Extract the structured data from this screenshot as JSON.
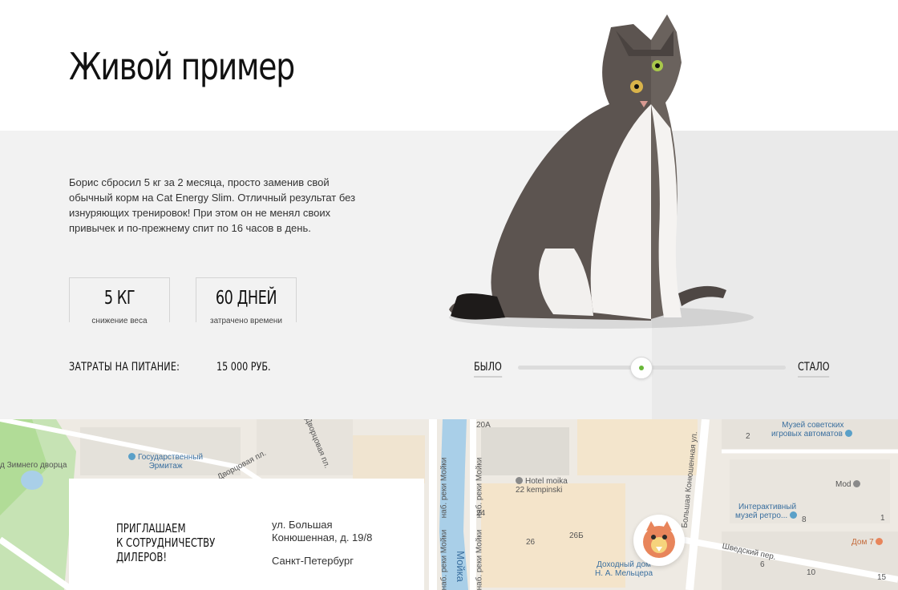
{
  "example": {
    "title": "Живой пример",
    "description": "Борис сбросил 5 кг за 2 месяца, просто заменив свой обычный корм на Cat Energy Slim. Отличный результат без изнуряющих тренировок! При этом он не менял своих привычек и по-прежнему спит по 16 часов в день.",
    "stats": [
      {
        "value": "5 КГ",
        "caption": "снижение веса"
      },
      {
        "value": "60 ДНЕЙ",
        "caption": "затрачено времени"
      }
    ],
    "cost_label": "ЗАТРАТЫ НА ПИТАНИЕ:",
    "cost_value": "15 000 РУБ.",
    "slider": {
      "before_label": "БЫЛО",
      "after_label": "СТАЛО",
      "position": 0.46
    },
    "colors": {
      "accent": "#68b738",
      "band": "#f2f2f2",
      "band_after": "#eaeaea"
    }
  },
  "map": {
    "labels": {
      "winter_palace": "д Зимнего\nдворца",
      "hermitage": "Государственный\nЭрмитаж",
      "dvortsovaya": "Дворцовая пл.",
      "dvortsovaya2": "Дворцовая пл.",
      "moika_hotel": "Hotel moika\n22 kempinski",
      "moika_river": "Мойка",
      "emb_moika1": "наб. реки Мойки",
      "emb_moika2": "наб. реки Мойки",
      "emb_moika3": "наб. реки Мойки",
      "emb_moika4": "наб. реки Мойки",
      "museum_arcade": "Музей советских\nигровых автоматов",
      "interactive_museum": "Интерактивный\nмузей ретро...",
      "mod": "Mod",
      "dom7": "Дом 7",
      "shvedsky": "Шведский пер.",
      "konyushennaya": "Большая Конюшенная ул.",
      "meltser": "Доходный дом\nН. А. Мельцера",
      "n24": "24",
      "n26": "26",
      "n26b": "26Б",
      "n20a": "20А",
      "n2": "2",
      "n8": "8",
      "n6": "6",
      "n10": "10",
      "n15": "15",
      "n1": "1"
    }
  },
  "contact": {
    "heading": "ПРИГЛАШАЕМ\nК СОТРУДНИЧЕСТВУ\nДИЛЕРОВ!",
    "address": "ул. Большая\nКонюшенная, д. 19/8",
    "city": "Санкт-Петербург"
  }
}
